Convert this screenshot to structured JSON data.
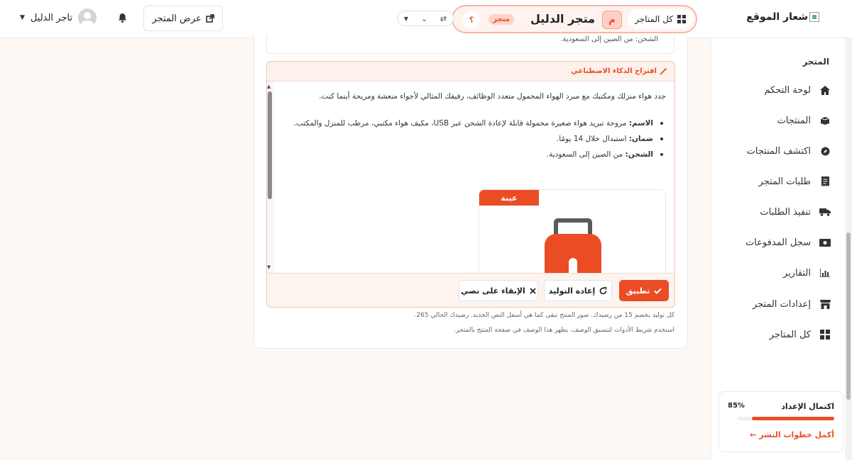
{
  "header": {
    "logo_text": "شعار الموقع",
    "all_stores_label": "كل المتاجر",
    "store_initial": "م",
    "store_name": "متجر الدليل",
    "store_badge": "متجر",
    "help_label": "؟",
    "view_store_label": "عرض المتجر",
    "user_name": "تاجر الدليل"
  },
  "sidebar": {
    "section_title": "المتجر",
    "items": [
      {
        "label": "لوحة التحكم",
        "icon": "home-icon"
      },
      {
        "label": "المنتجات",
        "icon": "box-icon"
      },
      {
        "label": "اكتشف المنتجات",
        "icon": "compass-icon"
      },
      {
        "label": "طلبات المتجر",
        "icon": "receipt-icon"
      },
      {
        "label": "تنفيذ الطلبات",
        "icon": "truck-icon"
      },
      {
        "label": "سجل المدفوعات",
        "icon": "money-icon"
      },
      {
        "label": "التقارير",
        "icon": "chart-icon"
      },
      {
        "label": "إعدادات المتجر",
        "icon": "store-icon"
      },
      {
        "label": "كل المتاجر",
        "icon": "grid-icon"
      }
    ],
    "progress": {
      "title": "اكتمال الإعداد",
      "percent_label": "85%",
      "percent": 85,
      "link_label": "أكمل خطوات النشر ←"
    }
  },
  "main": {
    "previous_text": "الشحن: من الصين إلى السعودية.",
    "ai": {
      "title": "اقتراح الذكاء الاصطناعي",
      "intro": "جدد هواء منزلك ومكتبك مع مبرد الهواء المحمول متعدد الوظائف، رفيقك المثالي لأجواء منعشة ومريحة أينما كنت.",
      "bullets": [
        {
          "key": "الاسم:",
          "value": " مروحة تبريد هواء صغيرة محمولة قابلة لإعادة الشحن عبر USB، مكيف هواء مكتبي، مرطب للمنزل والمكتب."
        },
        {
          "key": "ضمان:",
          "value": " استبدال خلال 14 يومًا."
        },
        {
          "key": "الشحن:",
          "value": " من الصين إلى السعودية."
        }
      ],
      "sample_tag": "عينة",
      "apply_label": "تطبيق",
      "regenerate_label": "إعادة التوليد",
      "keep_label": "الإبقاء على نصي"
    },
    "note_1": "كل توليد يخصم 15 من رصيدك. صور المنتج تبقى كما هي أسفل النص الجديد.   رصيدك الحالي 265.",
    "note_2": "استخدم شريط الأدوات لتنسيق الوصف. يظهر هذا الوصف في صفحة المنتج بالمتجر."
  },
  "colors": {
    "accent": "#ea4d24",
    "accent_soft": "#fff3ef",
    "background": "#fdf8f3"
  }
}
